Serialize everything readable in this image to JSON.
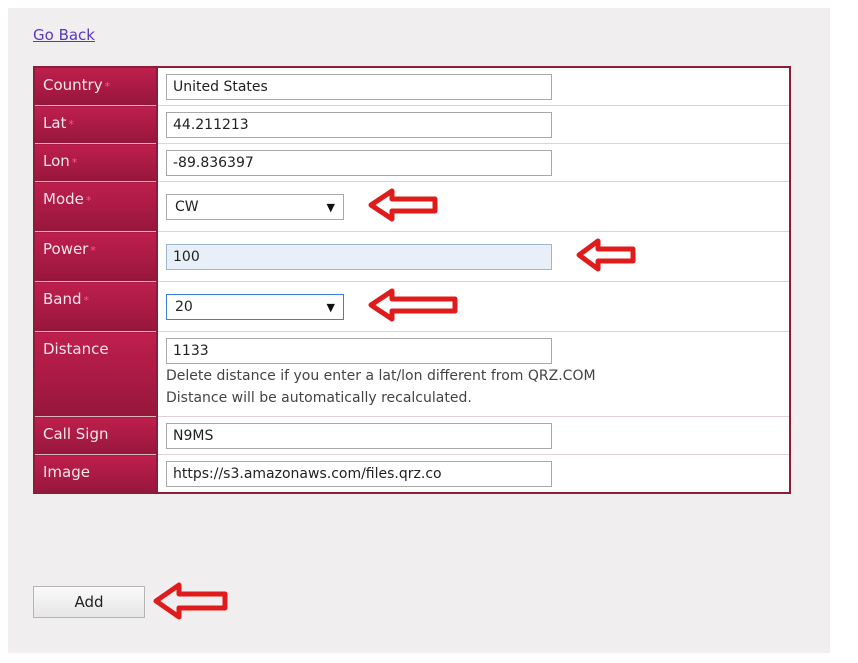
{
  "nav": {
    "back_label": "Go Back"
  },
  "fields": {
    "country": {
      "label": "Country",
      "value": "United States"
    },
    "lat": {
      "label": "Lat",
      "value": "44.211213"
    },
    "lon": {
      "label": "Lon",
      "value": "-89.836397"
    },
    "mode": {
      "label": "Mode",
      "value": "CW"
    },
    "power": {
      "label": "Power",
      "value": "100"
    },
    "band": {
      "label": "Band",
      "value": "20"
    },
    "distance": {
      "label": "Distance",
      "value": "1133",
      "help1": "Delete distance if you enter a lat/lon different from QRZ.COM",
      "help2": "Distance will be automatically recalculated."
    },
    "callsign": {
      "label": "Call Sign",
      "value": "N9MS"
    },
    "image": {
      "label": "Image",
      "value": "https://s3.amazonaws.com/files.qrz.co"
    }
  },
  "required_marker": "*",
  "actions": {
    "add_label": "Add"
  },
  "colors": {
    "label_bg": "#a51a44",
    "arrow": "#e01b1b"
  },
  "icons": {
    "dropdown": "triangle-down",
    "annotation": "red-arrow-left"
  }
}
